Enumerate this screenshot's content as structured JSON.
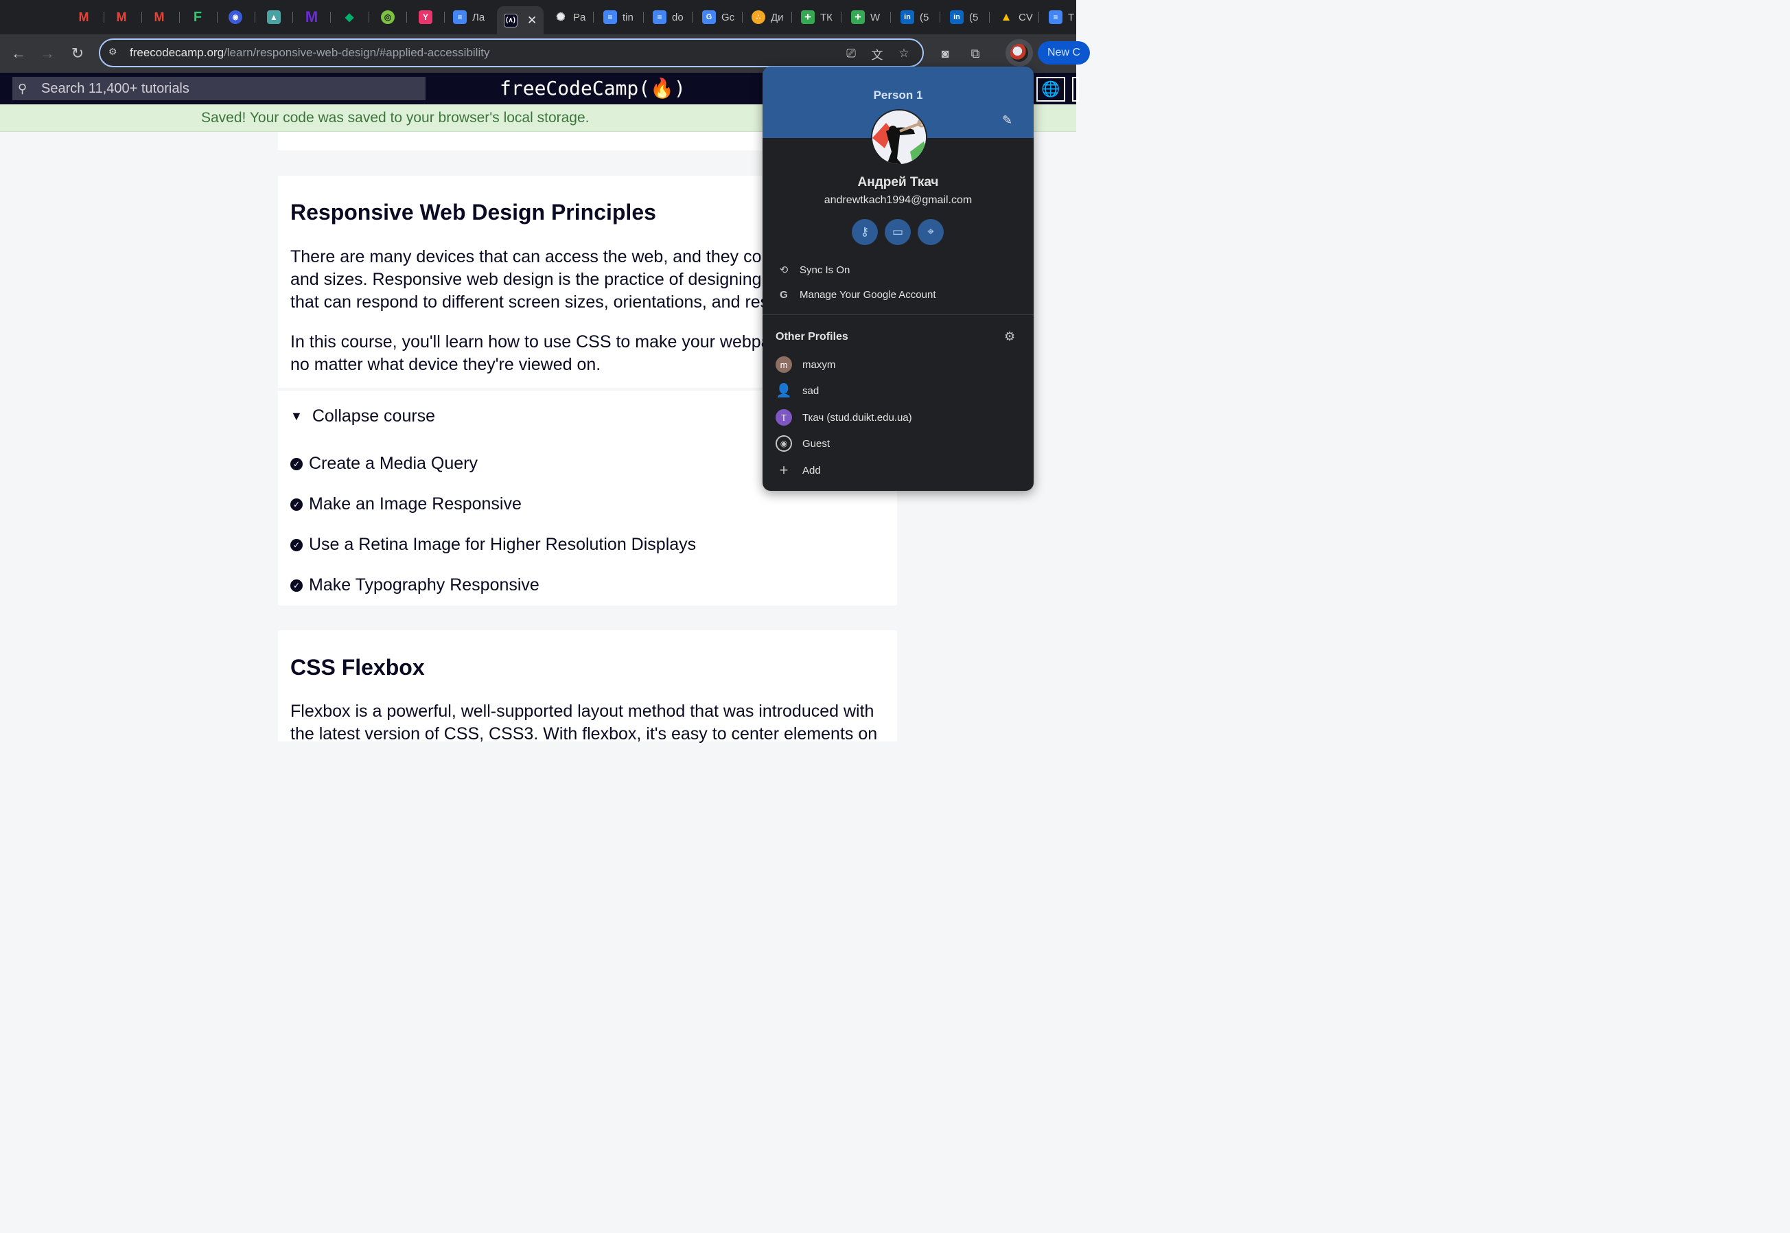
{
  "browser": {
    "tabs": [
      {
        "icon": "gmail-icon",
        "label": "",
        "color": "#ea4335"
      },
      {
        "icon": "gmail-icon",
        "label": "",
        "color": "#ea4335"
      },
      {
        "icon": "gmail-icon",
        "label": "",
        "color": "#ea4335"
      },
      {
        "icon": "f-logo-icon",
        "label": "",
        "color": "#2ecc71"
      },
      {
        "icon": "globe-badge-icon",
        "label": "",
        "color": "#3b5bdb"
      },
      {
        "icon": "contact-icon",
        "label": "",
        "color": "#4aa3a2"
      },
      {
        "icon": "m-logo-icon",
        "label": "",
        "color": "#6c2bd9"
      },
      {
        "icon": "leaf-icon",
        "label": "",
        "color": "#00b16a"
      },
      {
        "icon": "green-circle-icon",
        "label": "",
        "color": "#7cc242"
      },
      {
        "icon": "y-logo-icon",
        "label": "",
        "color": "#e8366b"
      },
      {
        "icon": "docs-icon",
        "label": "Ла",
        "color": "#4285f4"
      },
      {
        "icon": "fcc-icon",
        "label": "",
        "color": "#0a0a23"
      },
      {
        "icon": "chatgpt-icon",
        "label": "Pa",
        "color": "#202124"
      },
      {
        "icon": "docs-icon",
        "label": "tin",
        "color": "#4285f4"
      },
      {
        "icon": "docs-icon",
        "label": "do",
        "color": "#4285f4"
      },
      {
        "icon": "translate-icon",
        "label": "Gc",
        "color": "#4285f4"
      },
      {
        "icon": "orange-circles-icon",
        "label": "Ди",
        "color": "#f5a623"
      },
      {
        "icon": "sheets-plus-icon",
        "label": "ТК",
        "color": "#34a853"
      },
      {
        "icon": "sheets-plus-icon",
        "label": "W",
        "color": "#34a853"
      },
      {
        "icon": "linkedin-icon",
        "label": "(5",
        "color": "#0a66c2"
      },
      {
        "icon": "linkedin-icon",
        "label": "(5",
        "color": "#0a66c2"
      },
      {
        "icon": "drive-icon",
        "label": "CV",
        "color": "#fbbc04"
      },
      {
        "icon": "docs-icon",
        "label": "T",
        "color": "#4285f4"
      }
    ],
    "url_host": "freecodecamp.org",
    "url_path": "/learn/responsive-web-design/#applied-accessibility",
    "new_button": "New C"
  },
  "fcc": {
    "search_placeholder": "Search 11,400+ tutorials",
    "logo": "freeCodeCamp(🔥)",
    "saved_message": "Saved! Your code was saved to your browser's local storage."
  },
  "content": {
    "rwd_title": "Responsive Web Design Principles",
    "rwd_para1": [
      "There are many devices that can access the web, and they come",
      "and sizes. Responsive web design is the practice of designing fle",
      "that can respond to different screen sizes, orientations, and res"
    ],
    "rwd_para2": [
      "In this course, you'll learn how to use CSS to make your webpag",
      "no matter what device they're viewed on."
    ],
    "collapse_label": "Collapse course",
    "lessons": [
      "Create a Media Query",
      "Make an Image Responsive",
      "Use a Retina Image for Higher Resolution Displays",
      "Make Typography Responsive"
    ],
    "flex_title": "CSS Flexbox",
    "flex_para": [
      "Flexbox is a powerful, well-supported layout method that was introduced with",
      "the latest version of CSS, CSS3. With flexbox, it's easy to center elements on"
    ]
  },
  "profile_menu": {
    "profile_name": "Person 1",
    "user_name": "Андрей Ткач",
    "email": "andrewtkach1994@gmail.com",
    "sync": "Sync Is On",
    "manage": "Manage Your Google Account",
    "other_profiles_heading": "Other Profiles",
    "others": [
      {
        "label": "maxym",
        "initial": "m",
        "color": "#8d6e63"
      },
      {
        "label": "sad",
        "initial": "",
        "color": ""
      },
      {
        "label": "Ткач (stud.duikt.edu.ua)",
        "initial": "T",
        "color": "#7e57c2"
      },
      {
        "label": "Guest",
        "initial": "",
        "color": ""
      },
      {
        "label": "Add",
        "initial": "",
        "color": ""
      }
    ]
  }
}
